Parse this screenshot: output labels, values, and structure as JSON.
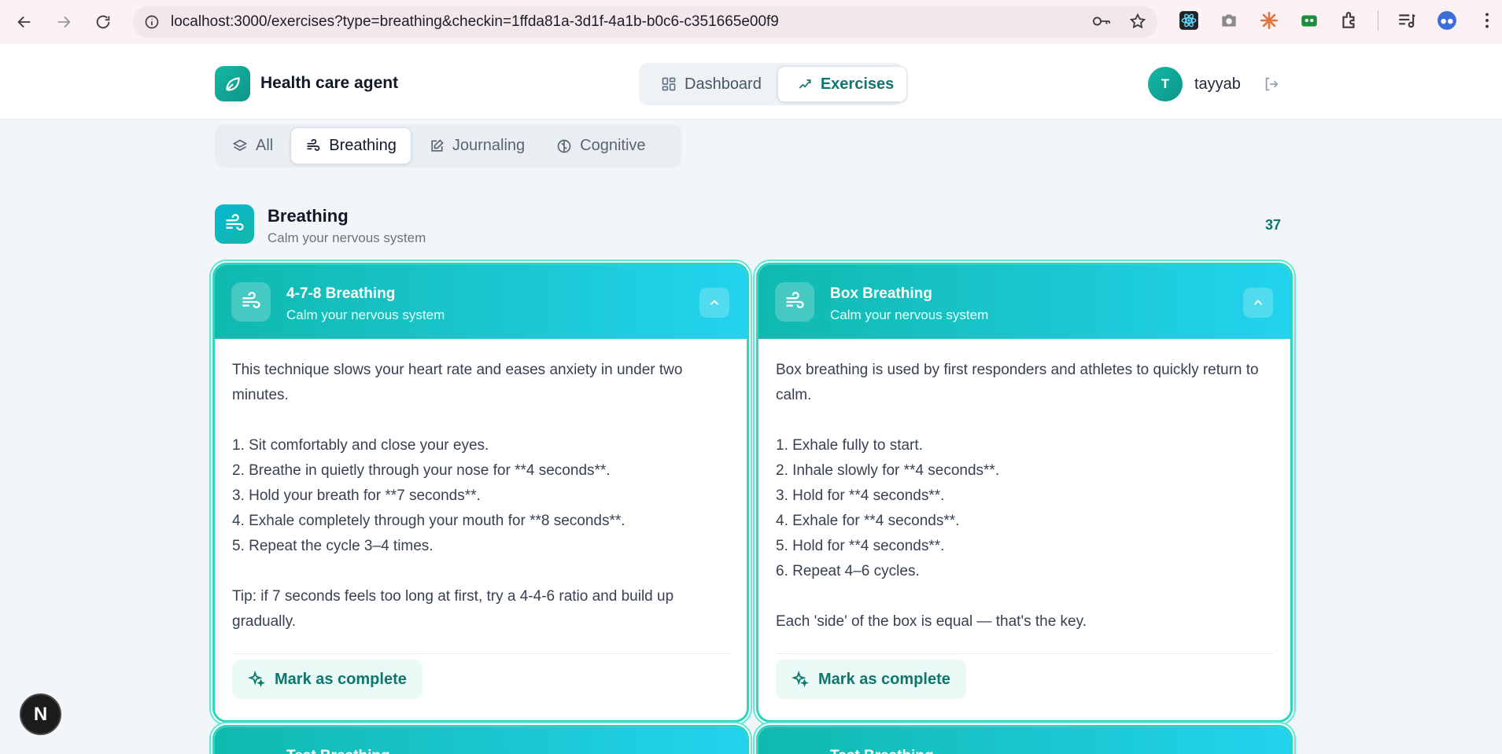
{
  "browser": {
    "url": "localhost:3000/exercises?type=breathing&checkin=1ffda81a-3d1f-4a1b-b0c6-c351665e00f9"
  },
  "header": {
    "brand": "Health care agent",
    "nav": [
      {
        "label": "Dashboard",
        "icon": "dashboard-icon",
        "active": false
      },
      {
        "label": "Exercises",
        "icon": "activity-icon",
        "active": true
      }
    ],
    "user_initial": "T",
    "username": "tayyab"
  },
  "categories": [
    {
      "label": "All",
      "icon": "layers-icon",
      "active": false
    },
    {
      "label": "Breathing",
      "icon": "wind-icon",
      "active": true
    },
    {
      "label": "Journaling",
      "icon": "edit-icon",
      "active": false
    },
    {
      "label": "Cognitive",
      "icon": "brain-icon",
      "active": false
    }
  ],
  "section": {
    "title": "Breathing",
    "subtitle": "Calm your nervous system",
    "count": "37"
  },
  "cards": [
    {
      "title": "4-7-8 Breathing",
      "subtitle": "Calm your nervous system",
      "lines": [
        "This technique slows your heart rate and eases anxiety in under two minutes.",
        "",
        "1. Sit comfortably and close your eyes.",
        "2. Breathe in quietly through your nose for **4 seconds**.",
        "3. Hold your breath for **7 seconds**.",
        "4. Exhale completely through your mouth for **8 seconds**.",
        "5. Repeat the cycle 3–4 times.",
        "",
        "Tip: if 7 seconds feels too long at first, try a 4-4-6 ratio and build up gradually."
      ],
      "button": "Mark as complete"
    },
    {
      "title": "Box Breathing",
      "subtitle": "Calm your nervous system",
      "lines": [
        "Box breathing is used by first responders and athletes to quickly return to calm.",
        "",
        "1. Exhale fully to start.",
        "2. Inhale slowly for **4 seconds**.",
        "3. Hold for **4 seconds**.",
        "4. Exhale for **4 seconds**.",
        "5. Hold for **4 seconds**.",
        "6. Repeat 4–6 cycles.",
        "",
        "Each 'side' of the box is equal — that's the key."
      ],
      "button": "Mark as complete"
    }
  ],
  "next_cards": [
    {
      "title": "Test Breathing"
    },
    {
      "title": "Test Breathing"
    }
  ],
  "dev_badge": "N",
  "colors": {
    "accent": "#0f766e",
    "teal": "#14b8a6",
    "cyan": "#22d3ee"
  }
}
